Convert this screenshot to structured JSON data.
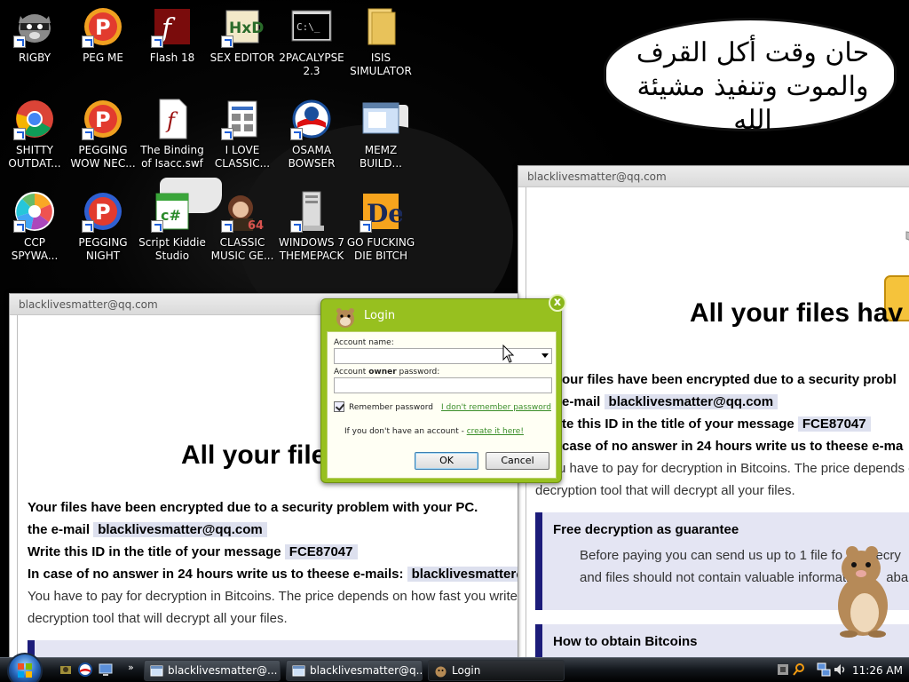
{
  "desktop": {
    "icons": [
      {
        "label": "RIGBY"
      },
      {
        "label": "PEG ME"
      },
      {
        "label": "Flash 18"
      },
      {
        "label": "SEX EDITOR"
      },
      {
        "label": "2PACALYPSE 2.3"
      },
      {
        "label": "ISIS SIMULATOR"
      },
      {
        "label": "SHITTY OUTDAT..."
      },
      {
        "label": "PEGGING WOW NEC..."
      },
      {
        "label": "The Binding of Isacc.swf"
      },
      {
        "label": "I LOVE CLASSIC..."
      },
      {
        "label": "OSAMA BOWSER"
      },
      {
        "label": "MEMZ BUILD..."
      },
      {
        "label": "CCP SPYWA..."
      },
      {
        "label": "PEGGING NIGHT"
      },
      {
        "label": "Script Kiddie Studio"
      },
      {
        "label": "CLASSIC MUSIC GE..."
      },
      {
        "label": "WINDOWS 7 THEMEPACK"
      },
      {
        "label": "GO FUCKING DIE BITCH"
      }
    ],
    "speech_bubble": "حان وقت أكل القرف\nوالموت وتنفيذ مشيئة الله"
  },
  "ransom_front": {
    "title": "blacklivesmatter@qq.com",
    "heading": "All your files have",
    "line1": "Your files have been encrypted due to a security problem with your PC.",
    "line2_prefix": "the e-mail",
    "email": "blacklivesmatter@qq.com",
    "line3_prefix": "Write this ID in the title of your message",
    "id": "FCE87047",
    "line4": "In case of no answer in 24 hours write us to theese e-mails:",
    "line5": "You have to pay for decryption in Bitcoins. The price depends on how fast you write",
    "line6": "decryption tool that will decrypt all your files."
  },
  "ransom_back": {
    "title": "blacklivesmatter@qq.com",
    "heading": "All your files hav",
    "line1": "our files have been encrypted due to a security probl",
    "line2_prefix": "e-mail",
    "email": "blacklivesmatter@qq.com",
    "line3_prefix": "te this ID in the title of your message",
    "id": "FCE87047",
    "line4": "case of no answer in 24 hours write us to theese e-ma",
    "line5": "u have to pay for decryption in Bitcoins. The price depends o",
    "line6": "decryption tool that will decrypt all your files.",
    "box1_title": "Free decryption as guarantee",
    "box1_text": "Before paying you can send us up to 1 file fo       decry\nand files should not contain valuable informatio        aba",
    "box2_title": "How to obtain Bitcoins"
  },
  "login": {
    "title": "Login",
    "close": "x",
    "account_label": "Account name:",
    "password_label_a": "Account ",
    "password_label_b": "owner",
    "password_label_c": " password:",
    "remember": "Remember password",
    "forgot": "I don't remember password",
    "no_account": "If you don't have an account - ",
    "create": "create it here!",
    "ok": "OK",
    "cancel": "Cancel"
  },
  "taskbar": {
    "more": "»",
    "buttons": [
      {
        "label": "blacklivesmatter@..."
      },
      {
        "label": "blacklivesmatter@q..."
      },
      {
        "label": "Login"
      }
    ],
    "clock": "11:26 AM"
  }
}
